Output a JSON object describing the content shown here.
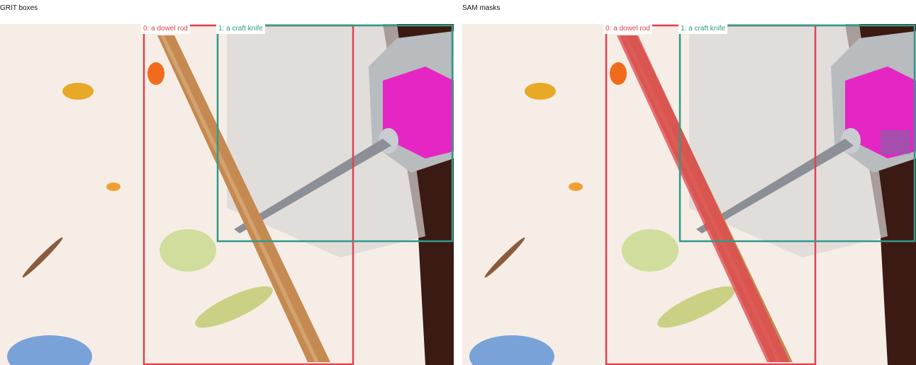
{
  "panels": [
    {
      "title": "GRIT boxes",
      "mode": "boxes",
      "objects": [
        {
          "label": "0: a dowel rod",
          "color": "#e0434f"
        },
        {
          "label": "1: a craft knife",
          "color": "#2f9a88"
        }
      ]
    },
    {
      "title": "SAM masks",
      "mode": "masks",
      "objects": [
        {
          "label": "0: a dowel rod",
          "color": "#e0434f"
        },
        {
          "label": "1: a craft knife",
          "color": "#2f9a88"
        }
      ]
    }
  ]
}
